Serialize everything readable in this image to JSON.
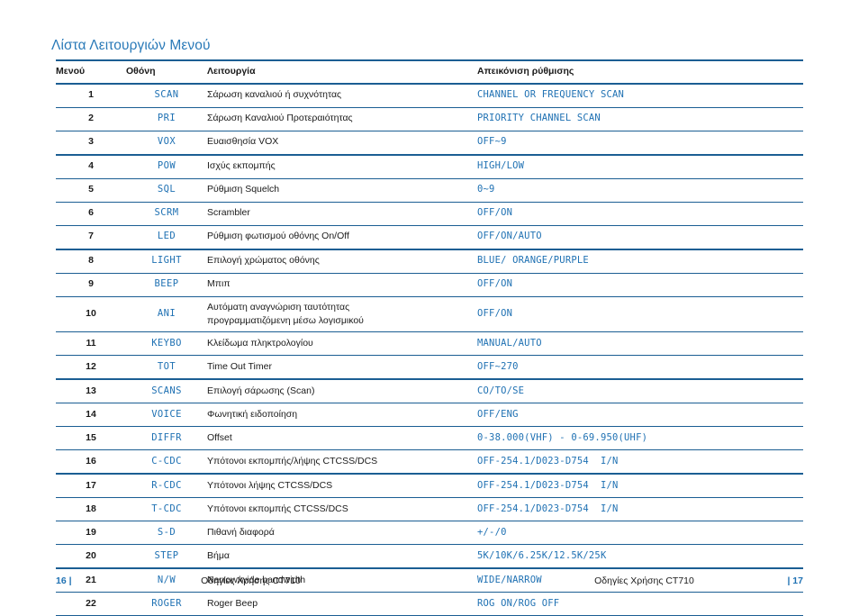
{
  "document": {
    "title": "Λίστα Λειτουργιών Μενού",
    "accent_color": "#1f71b3",
    "rule_color": "#1b5e93",
    "title_color": "#2a7ab8"
  },
  "table": {
    "headers": {
      "menu": "Μενού",
      "screen": "Οθόνη",
      "function": "Λειτουργία",
      "setting": "Απεικόνιση ρύθμισης"
    },
    "rows": [
      {
        "num": "1",
        "screen": "SCAN",
        "function": "Σάρωση καναλιού ή συχνότητας",
        "function2": "",
        "setting": "CHANNEL OR FREQUENCY SCAN",
        "thick": false
      },
      {
        "num": "2",
        "screen": "PRI",
        "function": "Σάρωση Καναλιού Προτεραιότητας",
        "function2": "",
        "setting": "PRIORITY CHANNEL SCAN",
        "thick": false
      },
      {
        "num": "3",
        "screen": "VOX",
        "function": "Ευαισθησία VOX",
        "function2": "",
        "setting": "OFF~9",
        "thick": true
      },
      {
        "num": "4",
        "screen": "POW",
        "function": "Ισχύς εκπομπής",
        "function2": "",
        "setting": "HIGH/LOW",
        "thick": false
      },
      {
        "num": "5",
        "screen": "SQL",
        "function": "Ρύθμιση Squelch",
        "function2": "",
        "setting": "0~9",
        "thick": false
      },
      {
        "num": "6",
        "screen": "SCRM",
        "function": "Scrambler",
        "function2": "",
        "setting": "OFF/ON",
        "thick": false
      },
      {
        "num": "7",
        "screen": "LED",
        "function": "Ρύθμιση φωτισμού οθόνης On/Off",
        "function2": "",
        "setting": "OFF/ON/AUTO",
        "thick": true
      },
      {
        "num": "8",
        "screen": "LIGHT",
        "function": "Επιλογή χρώματος οθόνης",
        "function2": "",
        "setting": "BLUE/ ORANGE/PURPLE",
        "thick": false
      },
      {
        "num": "9",
        "screen": "BEEP",
        "function": "Μπιπ",
        "function2": "",
        "setting": "OFF/ON",
        "thick": false
      },
      {
        "num": "10",
        "screen": "ANI",
        "function": "Αυτόματη αναγνώριση ταυτότητας",
        "function2": "προγραμματιζόμενη μέσω λογισμικού",
        "setting": "OFF/ON",
        "thick": false
      },
      {
        "num": "11",
        "screen": "KEYBO",
        "function": "Κλείδωμα πληκτρολογίου",
        "function2": "",
        "setting": "MANUAL/AUTO",
        "thick": false
      },
      {
        "num": "12",
        "screen": "TOT",
        "function": "Time Out Timer",
        "function2": "",
        "setting": "OFF~270",
        "thick": true
      },
      {
        "num": "13",
        "screen": "SCANS",
        "function": "Επιλογή σάρωσης (Scan)",
        "function2": "",
        "setting": "CO/TO/SE",
        "thick": false
      },
      {
        "num": "14",
        "screen": "VOICE",
        "function": "Φωνητική ειδοποίηση",
        "function2": "",
        "setting": "OFF/ENG",
        "thick": false
      },
      {
        "num": "15",
        "screen": "DIFFR",
        "function": "Offset",
        "function2": "",
        "setting": "0-38.000(VHF) - 0-69.950(UHF)",
        "thick": false
      },
      {
        "num": "16",
        "screen": "C-CDC",
        "function": "Υπότονοι εκπομπής/λήψης CTCSS/DCS",
        "function2": "",
        "setting": "OFF-254.1/D023-D754  I/N",
        "thick": true
      },
      {
        "num": "17",
        "screen": "R-CDC",
        "function": "Υπότονοι λήψης CTCSS/DCS",
        "function2": "",
        "setting": "OFF-254.1/D023-D754  I/N",
        "thick": false
      },
      {
        "num": "18",
        "screen": "T-CDC",
        "function": "Υπότονοι εκπομπής CTCSS/DCS",
        "function2": "",
        "setting": "OFF-254.1/D023-D754  I/N",
        "thick": false
      },
      {
        "num": "19",
        "screen": "S-D",
        "function": "Πιθανή διαφορά",
        "function2": "",
        "setting": "+/-/0",
        "thick": false
      },
      {
        "num": "20",
        "screen": "STEP",
        "function": "Βήμα",
        "function2": "",
        "setting": "5K/10K/6.25K/12.5K/25K",
        "thick": true
      },
      {
        "num": "21",
        "screen": "N/W",
        "function": "Narrow/wide bandwidth",
        "function2": "",
        "setting": "WIDE/NARROW",
        "thick": false
      },
      {
        "num": "22",
        "screen": "ROGER",
        "function": "Roger Beep",
        "function2": "",
        "setting": "ROG ON/ROG OFF",
        "thick": false
      }
    ]
  },
  "footer": {
    "left_page": "16 |",
    "left_doc": "Οδηγίες Χρήσης CT710",
    "right_doc": "Οδηγίες Χρήσης CT710",
    "right_page": "| 17"
  }
}
